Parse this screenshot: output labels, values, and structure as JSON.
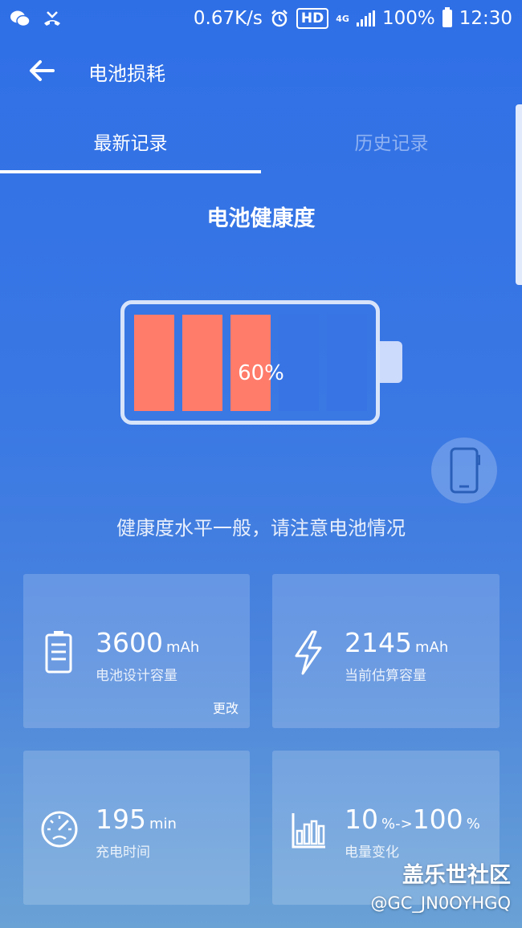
{
  "status_bar": {
    "network_speed": "0.67K/s",
    "hd_badge": "HD",
    "network_type": "4G",
    "battery_percent": "100%",
    "time": "12:30",
    "icons": [
      "wechat-icon",
      "missed-call-icon",
      "alarm-icon",
      "signal-icon",
      "battery-icon"
    ]
  },
  "app_bar": {
    "title": "电池损耗",
    "back_icon": "arrow-left-icon"
  },
  "tabs": [
    {
      "label": "最新记录",
      "active": true
    },
    {
      "label": "历史记录",
      "active": false
    }
  ],
  "health": {
    "title": "电池健康度",
    "percent_label": "60%",
    "level": 0.6,
    "cells_total": 5,
    "cells_filled": 3,
    "message": "健康度水平一般，请注意电池情况",
    "filled_color": "#ff7c6b",
    "empty_color": "#3874e4"
  },
  "cards": [
    {
      "icon": "battery-icon",
      "value": "3600",
      "unit": "mAh",
      "label": "电池设计容量",
      "link": "更改"
    },
    {
      "icon": "lightning-icon",
      "value": "2145",
      "unit": "mAh",
      "label": "当前估算容量"
    },
    {
      "icon": "speedometer-icon",
      "value": "195",
      "unit": "min",
      "label": "充电时间"
    },
    {
      "icon": "bar-chart-icon",
      "value_from": "10",
      "unit_from": "%->",
      "value_to": "100",
      "unit_to": "%",
      "label": "电量变化"
    }
  ],
  "watermark": {
    "line1": "盖乐世社区",
    "line2": "@GC_JN0OYHGQ"
  }
}
